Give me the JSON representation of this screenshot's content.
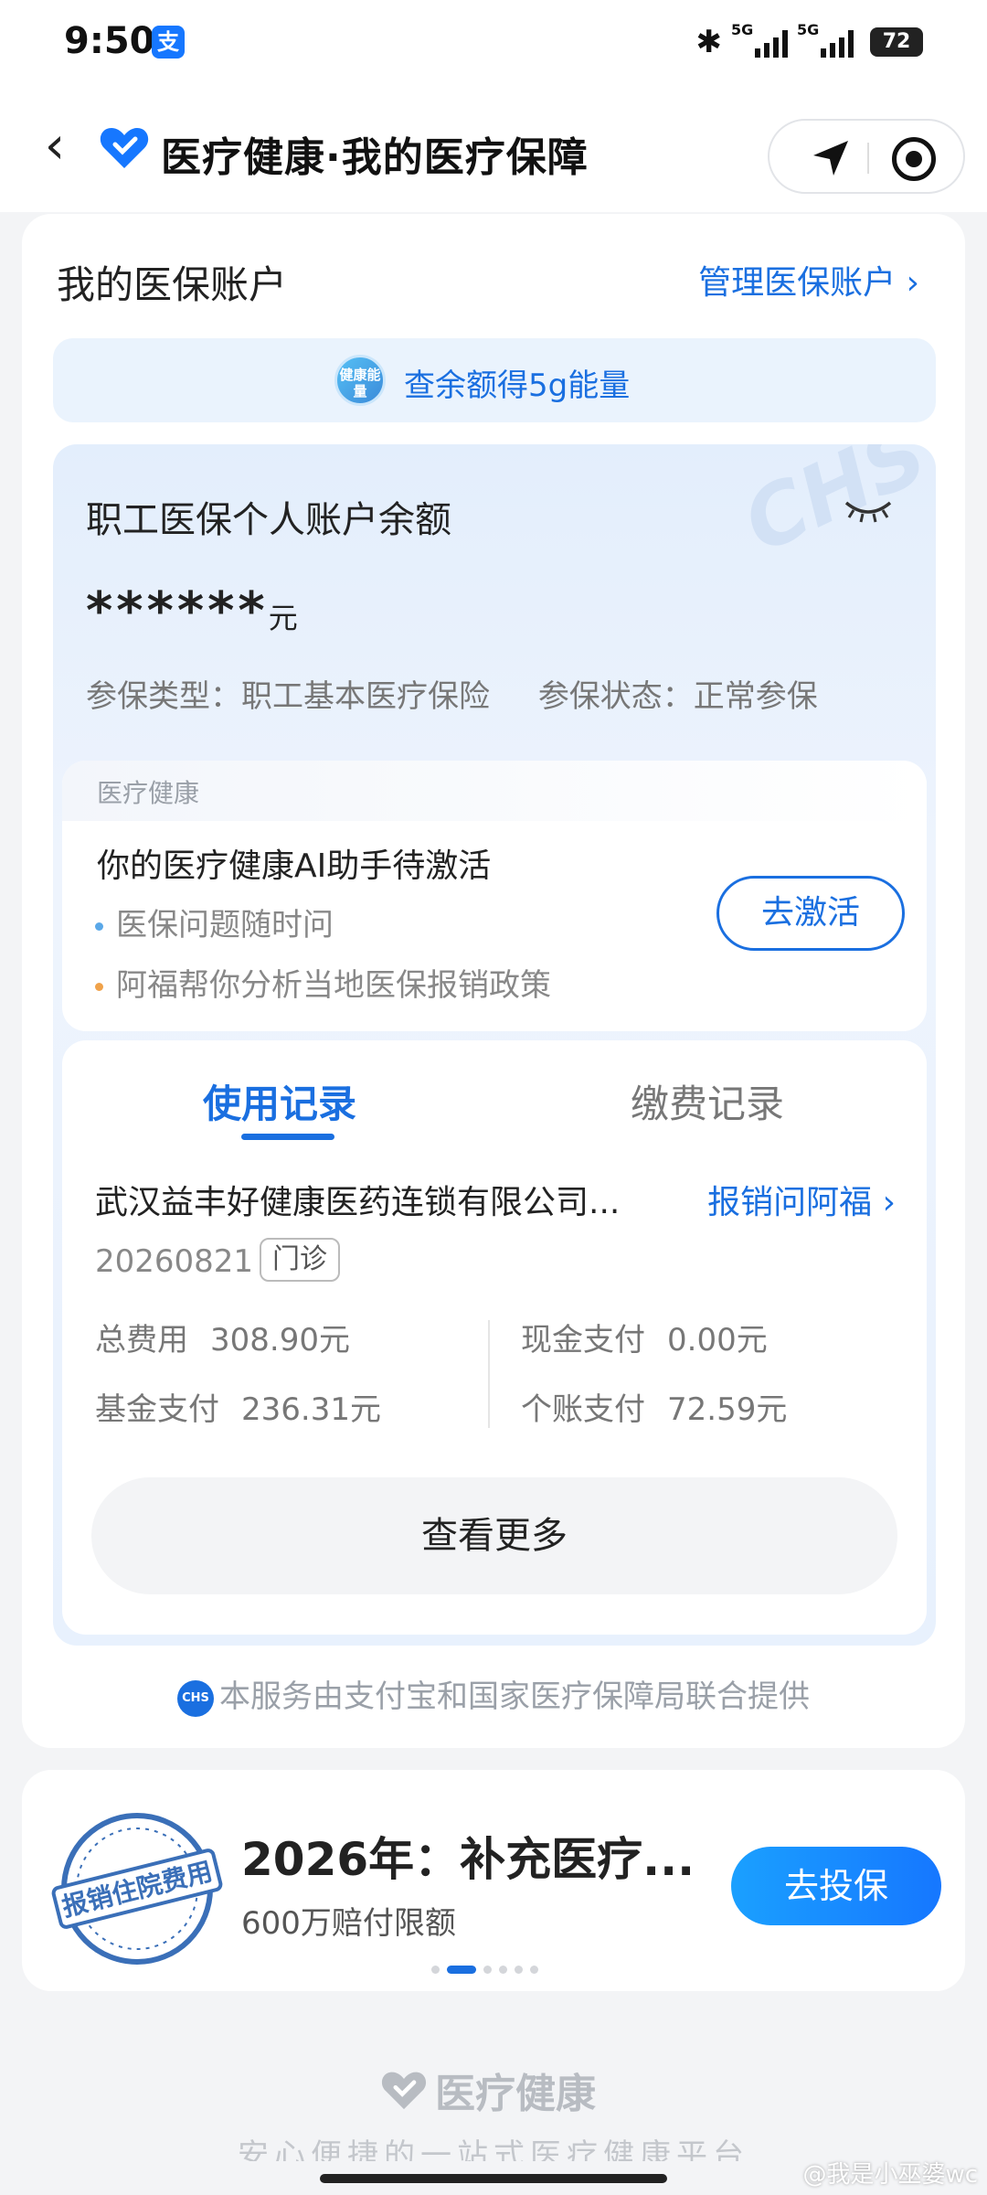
{
  "status_bar": {
    "time": "9:50",
    "app_badge": "支",
    "network_1": "5G",
    "network_2": "5G",
    "battery": "72"
  },
  "nav": {
    "back_icon": "back-chevron-icon",
    "title": "医疗健康·我的医疗保障",
    "location_icon": "location-arrow-icon",
    "close_icon": "target-circle-icon"
  },
  "account": {
    "title": "我的医保账户",
    "manage_link": "管理医保账户 ›",
    "energy_icon_text": "健康能量",
    "energy_text": "查余额得5g能量",
    "balance_title": "职工医保个人账户余额",
    "balance_masked": "******",
    "balance_unit": "元",
    "insurance_type": "参保类型：职工基本医疗保险",
    "insurance_status": "参保状态：正常参保"
  },
  "ai_assistant": {
    "tag": "医疗健康",
    "title": "你的医疗健康AI助手待激活",
    "bullet_1": "医保问题随时问",
    "bullet_1_color": "#5aa8e8",
    "bullet_2": "阿福帮你分析当地医保报销政策",
    "bullet_2_color": "#f0a24a",
    "activate_label": "去激活"
  },
  "records": {
    "tab_usage": "使用记录",
    "tab_payment": "缴费记录",
    "record": {
      "name": "武汉益丰好健康医药连锁有限公司...",
      "ask_link": "报销问阿福 ›",
      "date": "20260821",
      "type": "门诊",
      "total_label": "总费用",
      "total_value": "308.90元",
      "cash_label": "现金支付",
      "cash_value": "0.00元",
      "fund_label": "基金支付",
      "fund_value": "236.31元",
      "personal_label": "个账支付",
      "personal_value": "72.59元"
    },
    "more_label": "查看更多"
  },
  "footer_note": {
    "icon_text": "CHS",
    "text": "本服务由支付宝和国家医疗保障局联合提供"
  },
  "promo": {
    "stamp_text": "报销住院费用",
    "title": "2026年：补充医疗...",
    "subtitle": "600万赔付限额",
    "button": "去投保",
    "active_dot": 2,
    "dot_count": 6
  },
  "brand": {
    "name": "医疗健康",
    "slogan": "安心便捷的一站式医疗健康平台"
  },
  "watermark": "@我是小巫婆wc",
  "colors": {
    "accent": "#1a6fe0",
    "page_bg": "#f3f4f6"
  }
}
